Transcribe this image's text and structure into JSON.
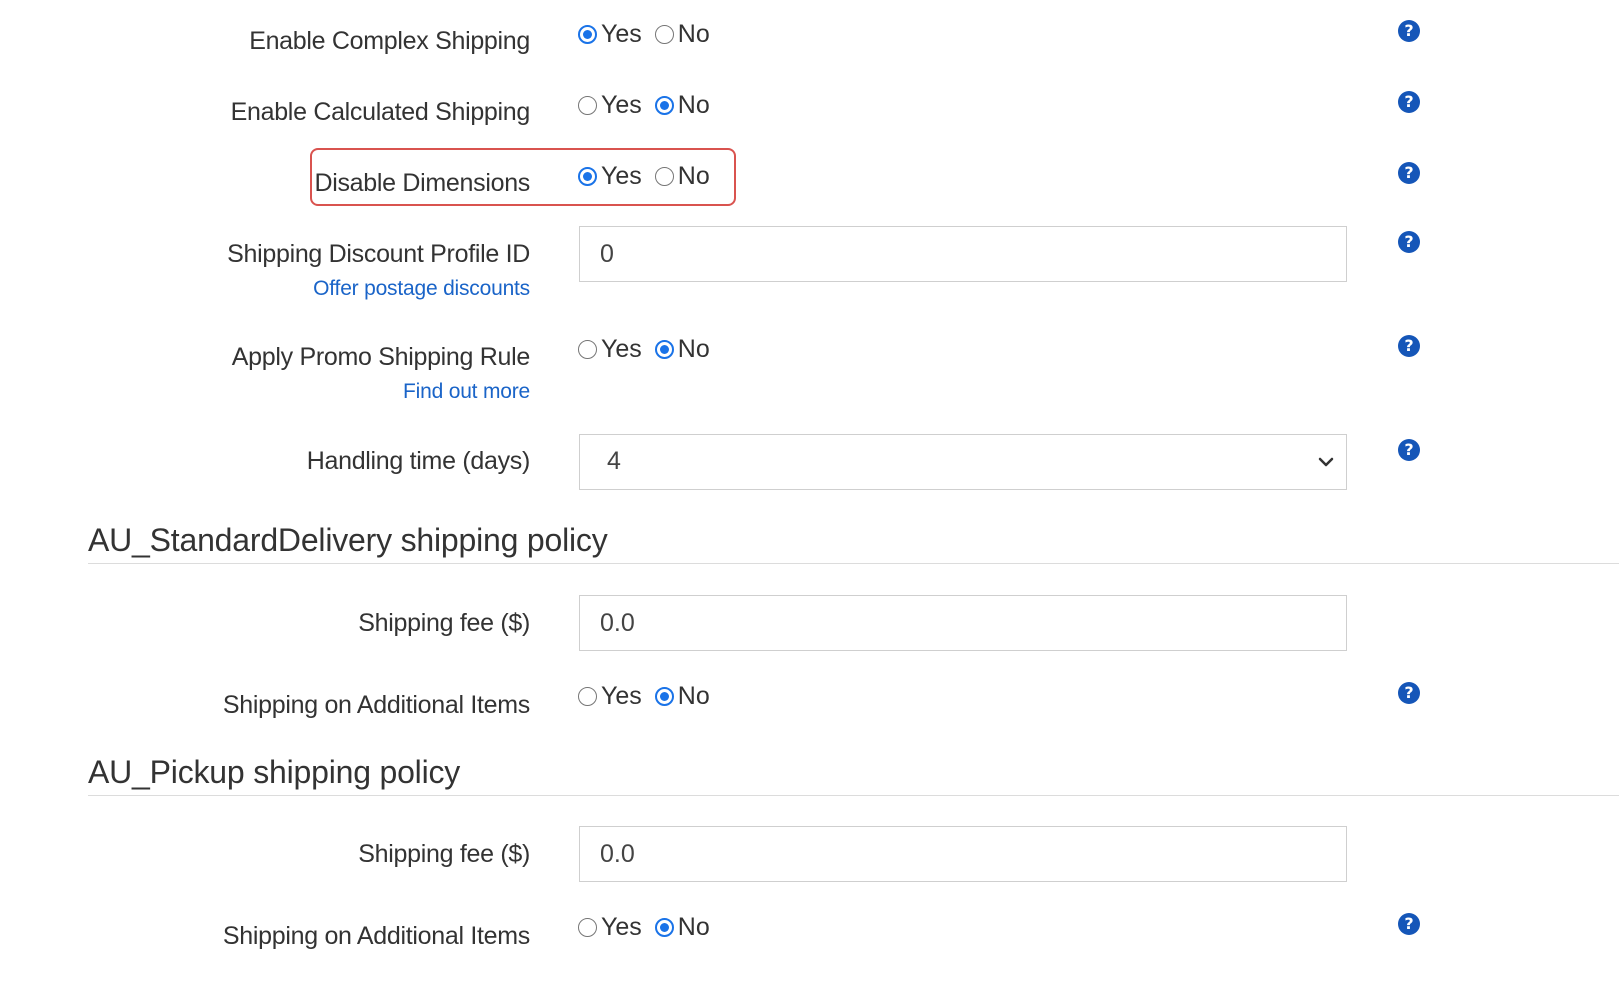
{
  "rows": {
    "complex_shipping": {
      "label": "Enable Complex Shipping",
      "options": [
        "Yes",
        "No"
      ],
      "selected": "Yes"
    },
    "calculated_shipping": {
      "label": "Enable Calculated Shipping",
      "options": [
        "Yes",
        "No"
      ],
      "selected": "No"
    },
    "disable_dimensions": {
      "label": "Disable Dimensions",
      "options": [
        "Yes",
        "No"
      ],
      "selected": "Yes"
    },
    "discount_profile": {
      "label": "Shipping Discount Profile ID",
      "link": "Offer postage discounts",
      "value": "0"
    },
    "promo_rule": {
      "label": "Apply Promo Shipping Rule",
      "link": "Find out more",
      "options": [
        "Yes",
        "No"
      ],
      "selected": "No"
    },
    "handling_time": {
      "label": "Handling time (days)",
      "value": "4"
    }
  },
  "sections": [
    {
      "title": "AU_StandardDelivery shipping policy",
      "fee_label": "Shipping fee ($)",
      "fee_value": "0.0",
      "additional_label": "Shipping on Additional Items",
      "options": [
        "Yes",
        "No"
      ],
      "selected": "No"
    },
    {
      "title": "AU_Pickup shipping policy",
      "fee_label": "Shipping fee ($)",
      "fee_value": "0.0",
      "additional_label": "Shipping on Additional Items",
      "options": [
        "Yes",
        "No"
      ],
      "selected": "No"
    }
  ],
  "icons": {
    "help": "question-circle-icon",
    "help_glyph": "?",
    "dropdown": "chevron-down-icon"
  },
  "colors": {
    "accent": "#1a73e8",
    "help_icon": "#1556b8",
    "link": "#1a64c8",
    "highlight": "#d9534f"
  }
}
